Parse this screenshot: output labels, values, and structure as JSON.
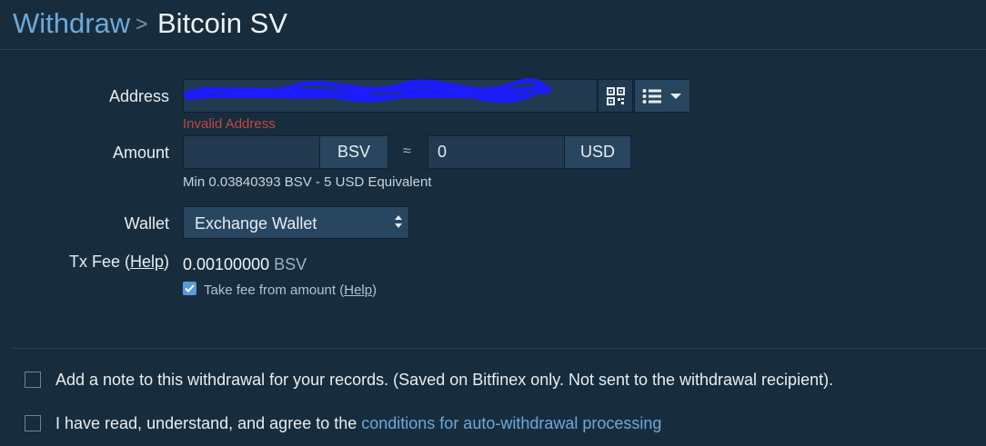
{
  "breadcrumb": {
    "parent": "Withdraw",
    "separator": ">",
    "current": "Bitcoin SV"
  },
  "address": {
    "label": "Address",
    "value": "",
    "error": "Invalid Address",
    "qr_icon": "qr-code-icon",
    "list_icon": "list-icon",
    "dropdown_icon": "caret-down-icon"
  },
  "amount": {
    "label": "Amount",
    "value": "",
    "currency": "BSV",
    "approx_symbol": "≈",
    "usd_value": "0",
    "usd_currency": "USD",
    "min_hint": "Min 0.03840393 BSV - 5 USD Equivalent"
  },
  "wallet": {
    "label": "Wallet",
    "selected": "Exchange Wallet"
  },
  "tx_fee": {
    "label": "Tx Fee (",
    "help": "Help",
    "label_close": ")",
    "value": "0.00100000",
    "unit": "BSV",
    "take_fee_checked": true,
    "take_fee_label": "Take fee from amount (",
    "take_fee_help": "Help",
    "take_fee_close": ")"
  },
  "note_option": {
    "checked": false,
    "label": "Add a note to this withdrawal for your records. (Saved on Bitfinex only. Not sent to the withdrawal recipient)."
  },
  "agree_option": {
    "checked": false,
    "label": "I have read, understand, and agree to the ",
    "link": "conditions for auto-withdrawal processing"
  },
  "colors": {
    "background": "#172d3e",
    "link": "#6fa8d8",
    "error": "#c0473f",
    "checkbox_checked": "#5b9ad6",
    "scribble": "#1c1cff"
  }
}
